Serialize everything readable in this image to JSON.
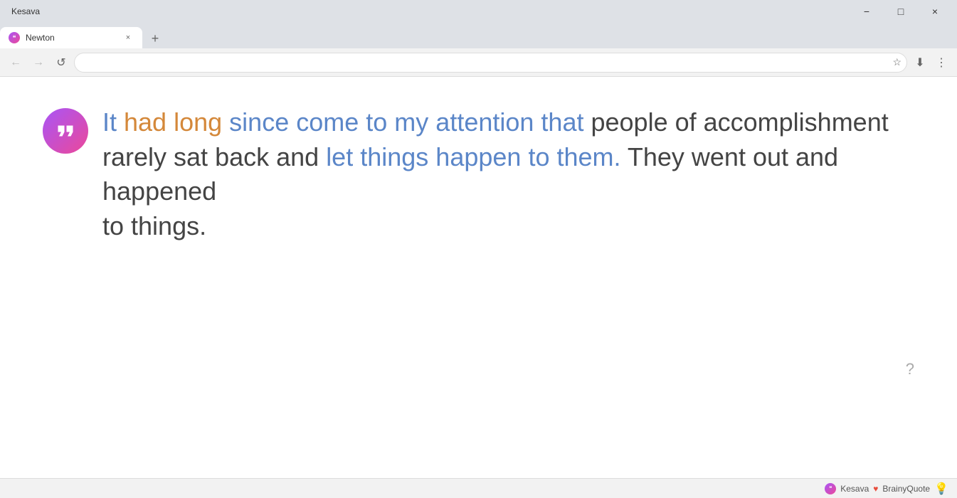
{
  "titlebar": {
    "app_name": "Kesava",
    "minimize_label": "−",
    "maximize_label": "□",
    "close_label": "×"
  },
  "tab": {
    "title": "Newton",
    "close_btn": "×",
    "new_tab_btn": "+"
  },
  "addressbar": {
    "back_btn": "←",
    "forward_btn": "→",
    "reload_btn": "↺",
    "url_placeholder": "",
    "url_value": "",
    "bookmark_icon": "☆",
    "download_icon": "⬇",
    "more_icon": "⋮"
  },
  "quote": {
    "icon_text": "❝",
    "text_part1": "It had long since come to my attention that people of accomplishment",
    "text_part2": "rarely sat back and let things happen to them. They went out and happened",
    "text_part3": "to things.",
    "full_text": "It had long since come to my attention that people of accomplishment rarely sat back and let things happen to them. They went out and happened to things."
  },
  "help": {
    "icon": "?"
  },
  "statusbar": {
    "logo_text": "❝",
    "brand_name": "Kesava",
    "heart": "♥",
    "source_name": "BrainyQuote",
    "lightbulb": "💡"
  }
}
